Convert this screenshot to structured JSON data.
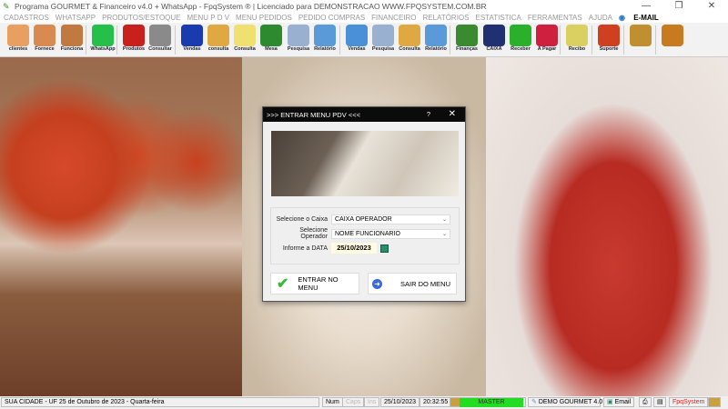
{
  "titlebar": {
    "title": "Programa GOURMET & Financeiro v4.0 + WhatsApp - FpqSystem ® | Licenciado para  DEMONSTRACAO WWW.FPQSYSTEM.COM.BR",
    "minimize": "—",
    "maximize": "❐",
    "close": "✕"
  },
  "menu": [
    "CADASTROS",
    "WHATSAPP",
    "PRODUTOS/ESTOQUE",
    "MENU P D V",
    "MENU PEDIDOS",
    "PEDIDO COMPRAS",
    "FINANCEIRO",
    "RELATÓRIOS",
    "ESTATISTICA",
    "FERRAMENTAS",
    "AJUDA"
  ],
  "menu_email": "E-MAIL",
  "toolbar": [
    {
      "label": "clientes",
      "color": "#e8a060"
    },
    {
      "label": "Fornece",
      "color": "#d98a50"
    },
    {
      "label": "Funciona",
      "color": "#c07a40"
    },
    {
      "label": "WhatsApp",
      "color": "#25c04a"
    },
    {
      "label": "Produtos",
      "color": "#c8201c"
    },
    {
      "label": "Consultar",
      "color": "#8a8a8a"
    },
    {
      "label": "Vendas",
      "color": "#1a3ab0"
    },
    {
      "label": "consulta",
      "color": "#e0a840"
    },
    {
      "label": "Consulta",
      "color": "#f0e070"
    },
    {
      "label": "Mesa",
      "color": "#2e8a2e"
    },
    {
      "label": "Pesquisa",
      "color": "#9ab0d0"
    },
    {
      "label": "Relatório",
      "color": "#5a9ad8"
    },
    {
      "label": "Vendas",
      "color": "#4a90d8"
    },
    {
      "label": "Pesquisa",
      "color": "#9ab0d0"
    },
    {
      "label": "Consulta",
      "color": "#e0a840"
    },
    {
      "label": "Relatório",
      "color": "#5a9ad8"
    },
    {
      "label": "Finanças",
      "color": "#3a8a30"
    },
    {
      "label": "CAIXA",
      "color": "#203070"
    },
    {
      "label": "Receber",
      "color": "#2ab02a"
    },
    {
      "label": "A Pagar",
      "color": "#d02040"
    },
    {
      "label": "Recibo",
      "color": "#d8d060"
    },
    {
      "label": "Suporte",
      "color": "#d04020"
    },
    {
      "label": "",
      "color": "#c09030"
    },
    {
      "label": "",
      "color": "#c87a20"
    }
  ],
  "dialog": {
    "title": ">>>  ENTRAR MENU PDV  <<<",
    "help": "?",
    "close": "✕",
    "caixa_label": "Selecione o Caixa",
    "caixa_value": "CAIXA OPERADOR",
    "operador_label": "Selecione Operador",
    "operador_value": "NOME FUNCIONARIO",
    "data_label": "Informe a DATA",
    "data_value": "25/10/2023",
    "enter_label": "ENTRAR NO MENU",
    "exit_label": "SAIR DO MENU"
  },
  "status": {
    "location": "SUA CIDADE - UF 25 de Outubro de 2023 - Quarta-feira",
    "num": "Num",
    "caps": "Caps",
    "ins": "Ins",
    "date": "25/10/2023",
    "time": "20:32:55",
    "user": "MASTER",
    "company": "DEMO GOURMET 4.0",
    "email": "Email",
    "brand": "FpqSystem"
  }
}
